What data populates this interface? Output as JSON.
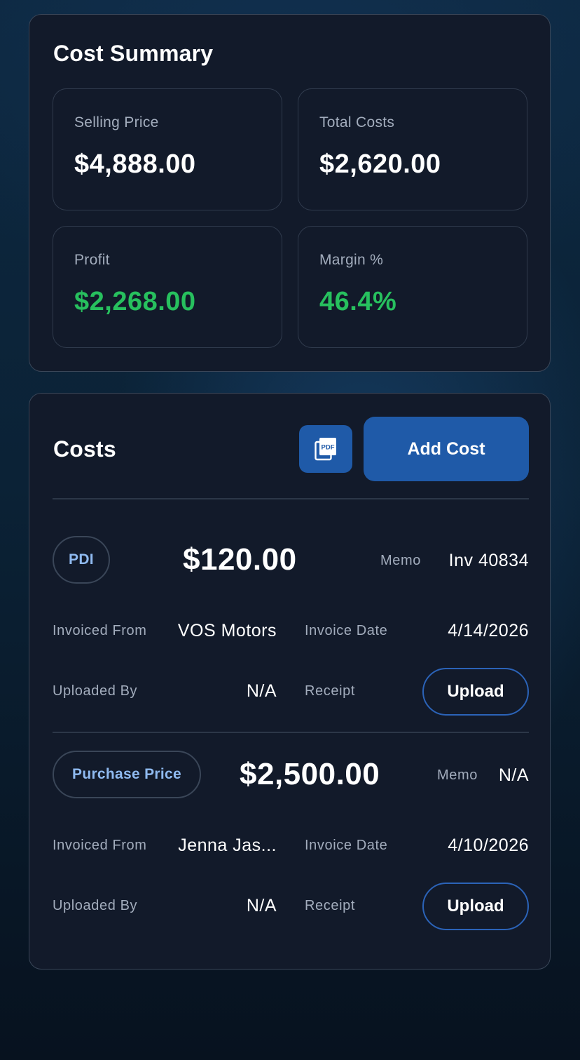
{
  "colors": {
    "accent": "#1f5aa8",
    "positive": "#27c05e",
    "card_bg": "#121a2a",
    "muted_text": "#a3adbd",
    "pill_text": "#8fbaf0"
  },
  "summary": {
    "title": "Cost Summary",
    "tiles": [
      {
        "label": "Selling Price",
        "value": "$4,888.00"
      },
      {
        "label": "Total Costs",
        "value": "$2,620.00"
      },
      {
        "label": "Profit",
        "value": "$2,268.00"
      },
      {
        "label": "Margin %",
        "value": "46.4%"
      }
    ]
  },
  "costs": {
    "title": "Costs",
    "pdf_icon": "pdf-icon",
    "add_label": "Add Cost",
    "labels": {
      "memo": "Memo",
      "invoiced_from": "Invoiced From",
      "invoice_date": "Invoice Date",
      "uploaded_by": "Uploaded By",
      "receipt": "Receipt",
      "upload": "Upload"
    },
    "items": [
      {
        "category": "PDI",
        "amount": "$120.00",
        "memo": "Inv 40834",
        "invoiced_from": "VOS Motors",
        "invoice_date": "4/14/2026",
        "uploaded_by": "N/A"
      },
      {
        "category": "Purchase Price",
        "amount": "$2,500.00",
        "memo": "N/A",
        "invoiced_from": "Jenna Jas...",
        "invoice_date": "4/10/2026",
        "uploaded_by": "N/A"
      }
    ]
  }
}
